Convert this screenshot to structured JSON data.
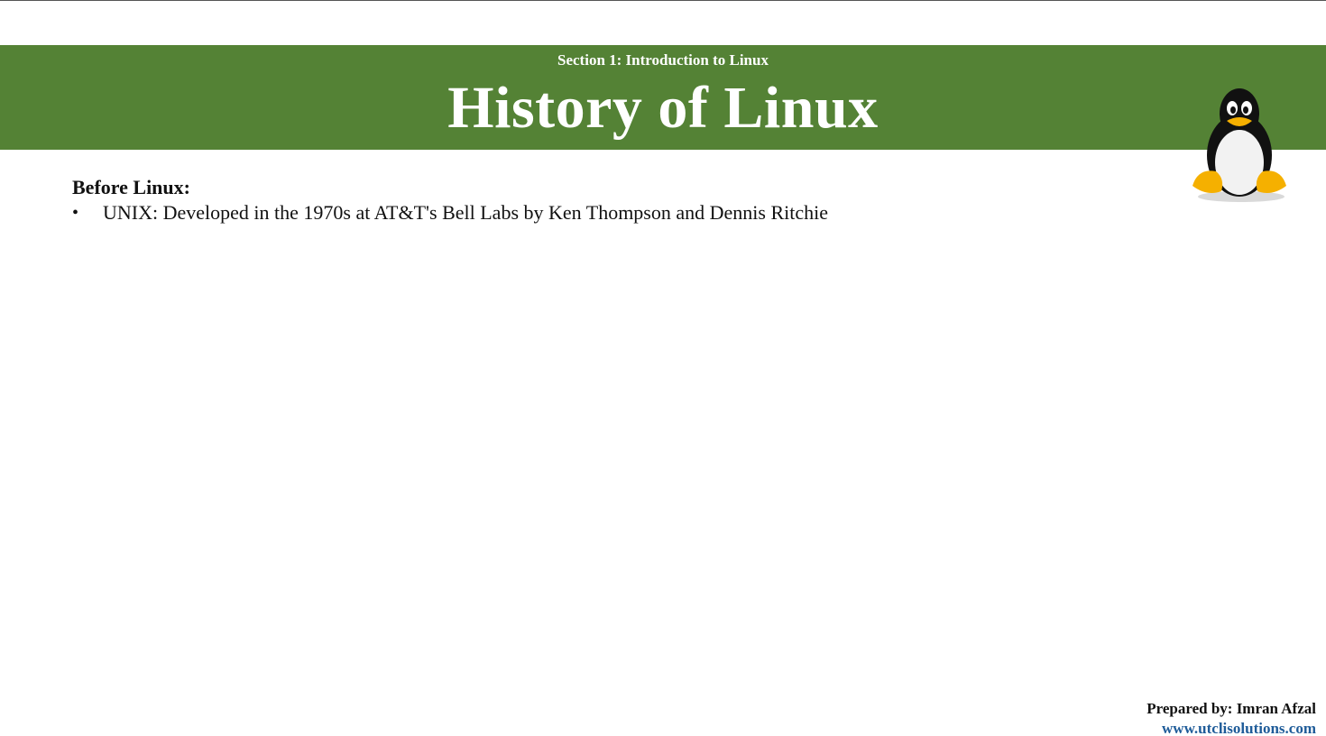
{
  "header": {
    "section_label": "Section 1: Introduction to Linux",
    "title": "History of Linux",
    "band_color": "#548235",
    "logo_icon": "tux-penguin-icon"
  },
  "content": {
    "subheading": "Before Linux:",
    "bullets": [
      "UNIX: Developed in the 1970s at AT&T's Bell Labs by Ken Thompson and Dennis Ritchie"
    ]
  },
  "footer": {
    "prepared_by": "Prepared by: Imran Afzal",
    "website": "www.utclisolutions.com",
    "website_color": "#1f5c99"
  }
}
